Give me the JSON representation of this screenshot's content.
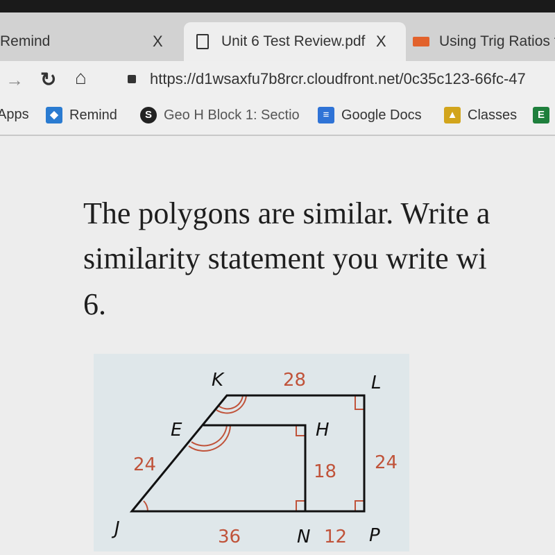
{
  "browser": {
    "tabs": [
      {
        "label": "Remind",
        "close": "X"
      },
      {
        "label": "Unit 6 Test Review.pdf",
        "close": "X",
        "active": true,
        "icon": "document-icon"
      },
      {
        "label": "Using Trig Ratios t",
        "icon": "slides-icon"
      }
    ],
    "url": "https://d1wsaxfu7b8rcr.cloudfront.net/0c35c123-66fc-47",
    "bookmarks": [
      {
        "label": "Apps"
      },
      {
        "label": "Remind",
        "icon": "remind-icon"
      },
      {
        "label": "Geo H Block 1: Sectio",
        "icon": "schoology-icon"
      },
      {
        "label": "Google Docs",
        "icon": "google-docs-icon"
      },
      {
        "label": "Classes",
        "icon": "classroom-icon"
      },
      {
        "label": "E",
        "icon": "bookmark-e-icon"
      }
    ]
  },
  "document": {
    "lines": [
      "The polygons are similar.  Write a",
      "similarity statement you write wi",
      "6."
    ],
    "diagram": {
      "vertices": [
        "K",
        "L",
        "E",
        "H",
        "J",
        "N",
        "P"
      ],
      "measures": {
        "KL": "28",
        "JE": "24",
        "LP": "24",
        "HN": "18",
        "JN": "36",
        "NP": "12"
      }
    }
  },
  "colors": {
    "measure": "#c0533a",
    "line": "#111111"
  }
}
